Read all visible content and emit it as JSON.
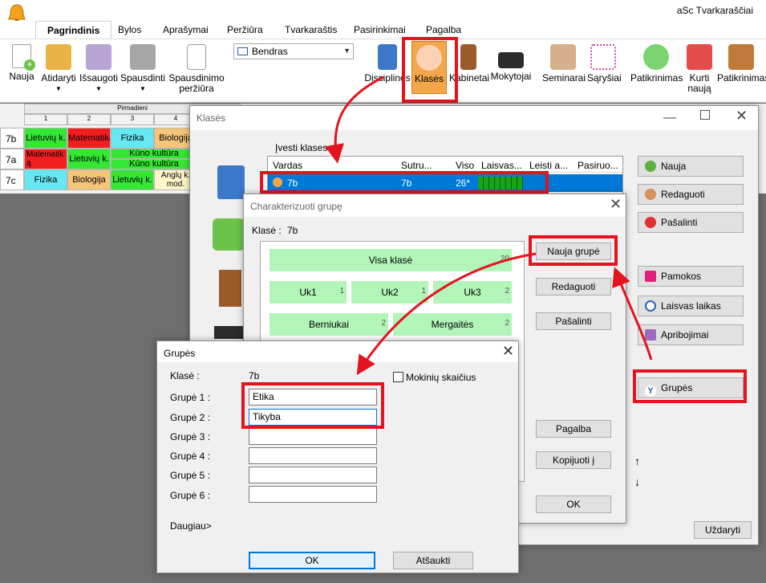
{
  "app": {
    "title": "aSc Tvarkaraščiai"
  },
  "tabs": [
    "Pagrindinis",
    "Bylos",
    "Aprašymai",
    "Peržiūra",
    "Tvarkaraštis",
    "Pasirinkimai",
    "Pagalba"
  ],
  "ribbon": {
    "file_buttons": [
      "Nauja",
      "Atidaryti",
      "Išsaugoti",
      "Spausdinti",
      "Spausdinimo",
      "peržiūra"
    ],
    "view_select": "Bendras",
    "data_buttons": [
      "Disciplinos",
      "Klasės",
      "Kabinetai",
      "Mokytojai"
    ],
    "tool_buttons": [
      "Seminarai",
      "Sąryšiai"
    ],
    "check_buttons": [
      "Patikrinimas",
      "Kurti",
      "naują",
      "Patikrinimas"
    ]
  },
  "timetable": {
    "day_label": "Pirmadieni",
    "periods": [
      "1",
      "2",
      "3",
      "4"
    ],
    "rows": [
      {
        "class": "7b",
        "cells": [
          "Lietuvių k.",
          "Matematika",
          "Fizika",
          "Biologija"
        ]
      },
      {
        "class": "7a",
        "cells": [
          "Matematik",
          "ą",
          "Lietuvių k.",
          "Kūno kultūra",
          "Kūno kultūra"
        ]
      },
      {
        "class": "7c",
        "cells": [
          "Fizika",
          "Biologija",
          "Lietuvių k.",
          "Anglų k.",
          "mod."
        ]
      }
    ]
  },
  "klases_dialog": {
    "title": "Klasės",
    "input_label": "Įvesti klases:",
    "columns": [
      "Vardas",
      "Sutru...",
      "Viso",
      "Laisvas...",
      "Leisti a...",
      "Pasiruo..."
    ],
    "selected_row": {
      "name": "7b",
      "short": "7b",
      "total": "26*"
    },
    "buttons": [
      "Nauja",
      "Redaguoti",
      "Pašalinti",
      "Pamokos",
      "Laisvas laikas",
      "Apribojimai",
      "Grupės",
      "Uždaryti"
    ],
    "arrows": [
      "↑",
      "↓"
    ]
  },
  "char_dialog": {
    "title": "Charakterizuoti grupę",
    "class_label": "Klasė :",
    "class_value": "7b",
    "groups": [
      {
        "name": "Visa klasė",
        "count": "20"
      },
      {
        "name": "Uk1",
        "count": "1"
      },
      {
        "name": "Uk2",
        "count": "1"
      },
      {
        "name": "Uk3",
        "count": "2"
      },
      {
        "name": "Berniukai",
        "count": "2"
      },
      {
        "name": "Mergaitės",
        "count": "2"
      }
    ],
    "buttons": [
      "Nauja grupė",
      "Redaguoti",
      "Pašalinti",
      "Pagalba",
      "Kopijuoti į",
      "OK"
    ]
  },
  "grupes_dialog": {
    "title": "Grupės",
    "class_label": "Klasė :",
    "class_value": "7b",
    "student_count_label": "Mokinių skaičius",
    "group_labels": [
      "Grupė 1 :",
      "Grupė 2 :",
      "Grupė 3 :",
      "Grupė 4 :",
      "Grupė 5 :",
      "Grupė 6 :"
    ],
    "group_values": [
      "Etika",
      "Tikyba",
      "",
      "",
      "",
      ""
    ],
    "more_label": "Daugiau>",
    "ok_label": "OK",
    "cancel_label": "Atšaukti"
  },
  "colors": {
    "accent": "#0078d7",
    "highlight": "#e3141e",
    "group_green": "#b2f5b8"
  }
}
